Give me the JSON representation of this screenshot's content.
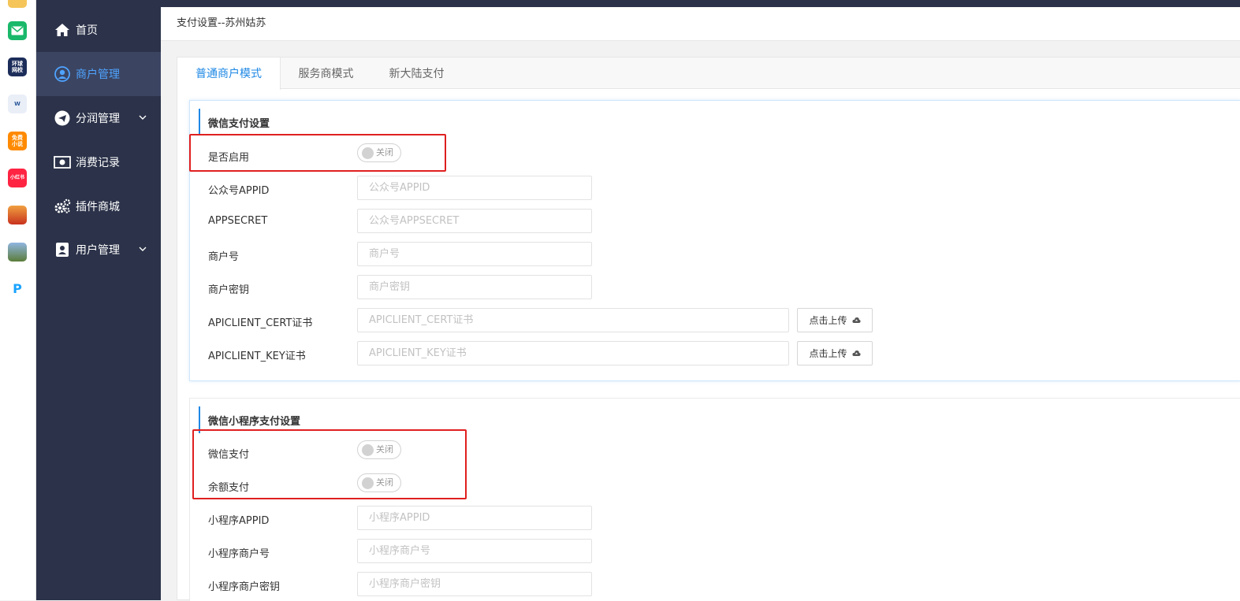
{
  "dock_apps": [
    {
      "name": "mail-app-icon",
      "text": "",
      "color": "#19b86a"
    },
    {
      "name": "huanqiu-app-icon",
      "text": "环球\n网校",
      "color": "#1c2d5a"
    },
    {
      "name": "word-app-icon",
      "text": "W",
      "color": "#e9eef7"
    },
    {
      "name": "novel-app-icon",
      "text": "免费\n小说",
      "color": "#ff8a00"
    },
    {
      "name": "xiaohongshu-app-icon",
      "text": "小红书",
      "color": "#ff2442"
    },
    {
      "name": "game-app-icon",
      "text": "",
      "color": "#d84b20"
    },
    {
      "name": "game2-app-icon",
      "text": "",
      "color": "#5b7d3a"
    },
    {
      "name": "pdf-app-icon",
      "text": "P",
      "color": "#ffffff"
    }
  ],
  "sidebar": {
    "items": [
      {
        "label": "首页",
        "icon": "home-icon"
      },
      {
        "label": "商户管理",
        "icon": "user-circle-icon",
        "active": true
      },
      {
        "label": "分润管理",
        "icon": "telegram-icon",
        "has_children": true
      },
      {
        "label": "消费记录",
        "icon": "money-icon"
      },
      {
        "label": "插件商城",
        "icon": "cogs-icon"
      },
      {
        "label": "用户管理",
        "icon": "address-book-icon",
        "has_children": true
      }
    ]
  },
  "breadcrumb": "支付设置--苏州姑苏",
  "tabs": [
    "普通商户模式",
    "服务商模式",
    "新大陆支付"
  ],
  "wechat_pay": {
    "title": "微信支付设置",
    "enable_label": "是否启用",
    "switch_off": "关闭",
    "appid_label": "公众号APPID",
    "appid_placeholder": "公众号APPID",
    "appsecret_label": "APPSECRET",
    "appsecret_placeholder": "公众号APPSECRET",
    "mchid_label": "商户号",
    "mchid_placeholder": "商户号",
    "mchkey_label": "商户密钥",
    "mchkey_placeholder": "商户密钥",
    "cert_label": "APICLIENT_CERT证书",
    "cert_placeholder": "APICLIENT_CERT证书",
    "key_label": "APICLIENT_KEY证书",
    "key_placeholder": "APICLIENT_KEY证书",
    "upload_label": "点击上传"
  },
  "mini_pay": {
    "title": "微信小程序支付设置",
    "wechat_label": "微信支付",
    "balance_label": "余额支付",
    "switch_off": "关闭",
    "appid_label": "小程序APPID",
    "appid_placeholder": "小程序APPID",
    "mchid_label": "小程序商户号",
    "mchid_placeholder": "小程序商户号",
    "mchkey_label": "小程序商户密钥",
    "mchkey_placeholder": "小程序商户密钥"
  },
  "colors": {
    "sidebar_bg": "#2b3249",
    "active_blue": "#1e88e5",
    "highlight_red": "#e02020"
  }
}
